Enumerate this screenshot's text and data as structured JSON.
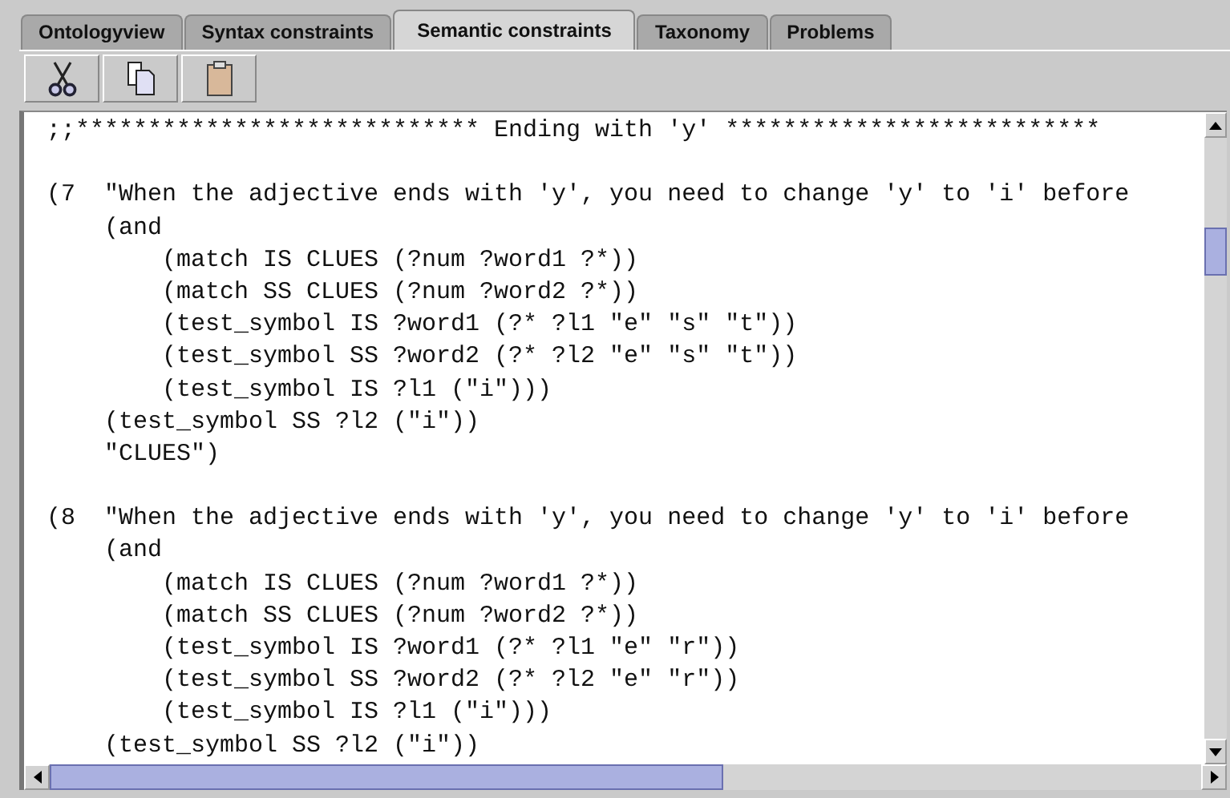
{
  "tabs": [
    {
      "label": "Ontologyview",
      "selected": false
    },
    {
      "label": "Syntax constraints",
      "selected": false
    },
    {
      "label": "Semantic constraints",
      "selected": true
    },
    {
      "label": "Taxonomy",
      "selected": false
    },
    {
      "label": "Problems",
      "selected": false
    }
  ],
  "toolbar": [
    {
      "kind": "cut"
    },
    {
      "kind": "copy"
    },
    {
      "kind": "paste"
    }
  ],
  "editor": {
    "blocks": [
      {
        "lines": [
          ";;**************************** Ending with 'y' **************************"
        ]
      },
      {
        "lines": [
          "(7  \"When the adjective ends with 'y', you need to change 'y' to 'i' before",
          "    (and",
          "        (match IS CLUES (?num ?word1 ?*))",
          "        (match SS CLUES (?num ?word2 ?*))",
          "        (test_symbol IS ?word1 (?* ?l1 \"e\" \"s\" \"t\"))",
          "        (test_symbol SS ?word2 (?* ?l2 \"e\" \"s\" \"t\"))",
          "        (test_symbol IS ?l1 (\"i\")))",
          "    (test_symbol SS ?l2 (\"i\"))",
          "    \"CLUES\")"
        ]
      },
      {
        "lines": [
          "(8  \"When the adjective ends with 'y', you need to change 'y' to 'i' before",
          "    (and",
          "        (match IS CLUES (?num ?word1 ?*))",
          "        (match SS CLUES (?num ?word2 ?*))",
          "        (test_symbol IS ?word1 (?* ?l1 \"e\" \"r\"))",
          "        (test_symbol SS ?word2 (?* ?l2 \"e\" \"r\"))",
          "        (test_symbol IS ?l1 (\"i\")))",
          "    (test_symbol SS ?l2 (\"i\"))"
        ]
      }
    ]
  }
}
